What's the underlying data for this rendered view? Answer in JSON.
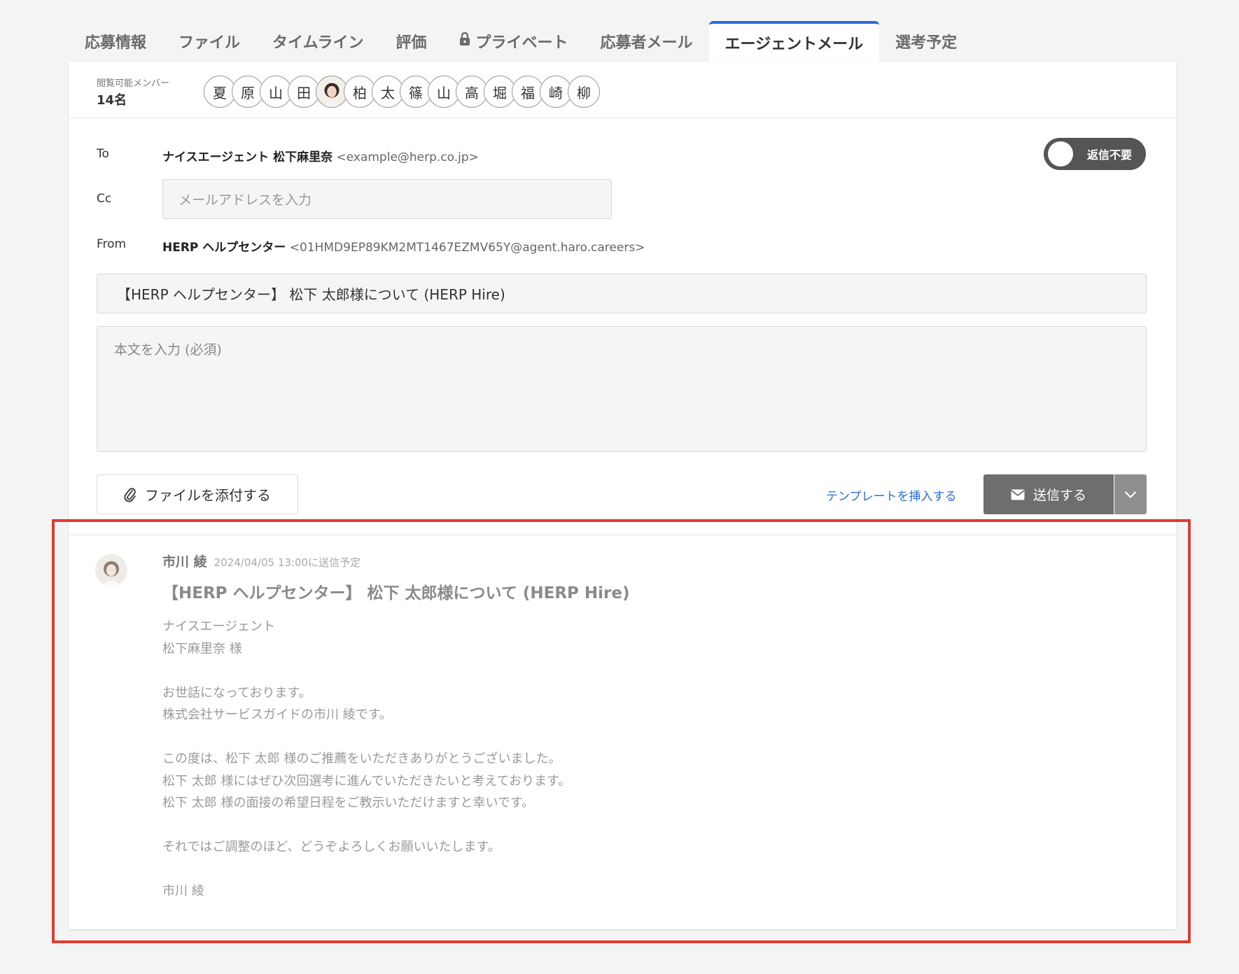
{
  "tabs": [
    {
      "label": "応募情報",
      "active": false
    },
    {
      "label": "ファイル",
      "active": false
    },
    {
      "label": "タイムライン",
      "active": false
    },
    {
      "label": "評価",
      "active": false
    },
    {
      "label": "プライベート",
      "active": false,
      "icon": "lock-icon"
    },
    {
      "label": "応募者メール",
      "active": false
    },
    {
      "label": "エージェントメール",
      "active": true
    },
    {
      "label": "選考予定",
      "active": false
    }
  ],
  "members": {
    "label": "閲覧可能メンバー",
    "count": "14名",
    "avatars": [
      "夏",
      "原",
      "山",
      "田",
      "photo",
      "柏",
      "太",
      "篠",
      "山",
      "高",
      "堀",
      "福",
      "崎",
      "柳"
    ]
  },
  "compose": {
    "to_label": "To",
    "to_name": "ナイスエージェント 松下麻里奈",
    "to_email": "<example@herp.co.jp>",
    "no_reply_toggle": "返信不要",
    "cc_label": "Cc",
    "cc_placeholder": "メールアドレスを入力",
    "from_label": "From",
    "from_name": "HERP ヘルプセンター",
    "from_email": "<01HMD9EP89KM2MT1467EZMV65Y@agent.haro.careers>",
    "subject_value": "【HERP ヘルプセンター】 松下 太郎様について (HERP Hire)",
    "body_placeholder": "本文を入力 (必須)",
    "attach_label": "ファイルを添付する",
    "template_link": "テンプレートを挿入する",
    "send_label": "送信する"
  },
  "scheduled_message": {
    "sender": "市川 綾",
    "time": "2024/04/05 13:00に送信予定",
    "subject": "【HERP ヘルプセンター】 松下 太郎様について (HERP Hire)",
    "body_lines": [
      "ナイスエージェント",
      "松下麻里奈 様",
      "",
      "お世話になっております。",
      "株式会社サービスガイドの市川 綾です。",
      "",
      "この度は、松下 太郎 様のご推薦をいただきありがとうございました。",
      "松下 太郎 様にはぜひ次回選考に進んでいただきたいと考えております。",
      "松下 太郎 様の面接の希望日程をご教示いただけますと幸いです。",
      "",
      "それではご調整のほど、どうぞよろしくお願いいたします。",
      "",
      "市川 綾"
    ]
  },
  "colors": {
    "active_tab_accent": "#2b6bd6",
    "link": "#2b6bd6",
    "highlight": "#e53a2f",
    "send_button": "#6e6e6e"
  }
}
